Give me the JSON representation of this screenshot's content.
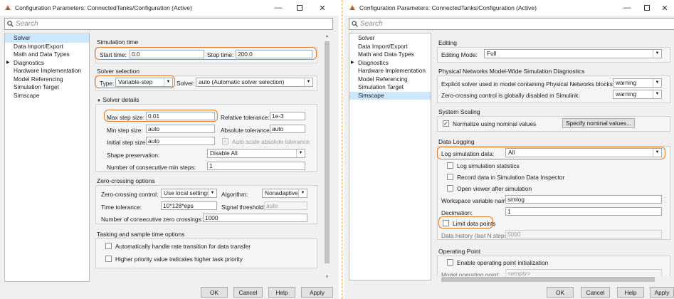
{
  "left": {
    "title": "Configuration Parameters: ConnectedTanks/Configuration (Active)",
    "search_placeholder": "Search",
    "tree": [
      "Solver",
      "Data Import/Export",
      "Math and Data Types",
      "Diagnostics",
      "Hardware Implementation",
      "Model Referencing",
      "Simulation Target",
      "Simscape"
    ],
    "sim_time": {
      "title": "Simulation time",
      "start_label": "Start time:",
      "start_value": "0.0",
      "stop_label": "Stop time:",
      "stop_value": "200.0"
    },
    "solver_selection": {
      "title": "Solver selection",
      "type_label": "Type:",
      "type_value": "Variable-step",
      "solver_label": "Solver:",
      "solver_value": "auto (Automatic solver selection)"
    },
    "solver_details": {
      "title": "Solver details",
      "max_step_label": "Max step size:",
      "max_step_value": "0.01",
      "rel_tol_label": "Relative tolerance:",
      "rel_tol_value": "1e-3",
      "min_step_label": "Min step size:",
      "min_step_value": "auto",
      "abs_tol_label": "Absolute tolerance:",
      "abs_tol_value": "auto",
      "init_step_label": "Initial step size:",
      "init_step_value": "auto",
      "auto_scale_label": "Auto scale absolute tolerance",
      "shape_label": "Shape preservation:",
      "shape_value": "Disable All",
      "consec_min_label": "Number of consecutive min steps:",
      "consec_min_value": "1"
    },
    "zero_crossing": {
      "title": "Zero-crossing options",
      "control_label": "Zero-crossing control:",
      "control_value": "Use local settings",
      "algorithm_label": "Algorithm:",
      "algorithm_value": "Nonadaptive",
      "time_tol_label": "Time tolerance:",
      "time_tol_value": "10*128*eps",
      "signal_label": "Signal threshold:",
      "signal_value": "auto",
      "consec_zc_label": "Number of consecutive zero crossings:",
      "consec_zc_value": "1000"
    },
    "tasking": {
      "title": "Tasking and sample time options",
      "opt1": "Automatically handle rate transition for data transfer",
      "opt2": "Higher priority value indicates higher task priority"
    },
    "buttons": {
      "ok": "OK",
      "cancel": "Cancel",
      "help": "Help",
      "apply": "Apply"
    }
  },
  "right": {
    "title": "Configuration Parameters: ConnectedTanks/Configuration (Active)",
    "search_placeholder": "Search",
    "tree": [
      "Solver",
      "Data Import/Export",
      "Math and Data Types",
      "Diagnostics",
      "Hardware Implementation",
      "Model Referencing",
      "Simulation Target",
      "Simscape"
    ],
    "editing": {
      "title": "Editing",
      "mode_label": "Editing Mode:",
      "mode_value": "Full"
    },
    "pn_diag": {
      "title": "Physical Networks Model-Wide Simulation Diagnostics",
      "explicit_label": "Explicit solver used in model containing Physical Networks blocks:",
      "explicit_value": "warning",
      "zc_label": "Zero-crossing control is globally disabled in Simulink:",
      "zc_value": "warning"
    },
    "scaling": {
      "title": "System Scaling",
      "normalize_label": "Normalize using nominal values",
      "specify_button": "Specify nominal values..."
    },
    "logging": {
      "title": "Data Logging",
      "log_label": "Log simulation data:",
      "log_value": "All",
      "stats_label": "Log simulation statistics",
      "record_label": "Record data in Simulation Data Inspector",
      "viewer_label": "Open viewer after simulation",
      "workspace_label": "Workspace variable name:",
      "workspace_value": "simlog",
      "decimation_label": "Decimation:",
      "decimation_value": "1",
      "limit_label": "Limit data points",
      "history_label": "Data history (last N steps):",
      "history_value": "5000"
    },
    "op_point": {
      "title": "Operating Point",
      "enable_label": "Enable operating point initialization",
      "model_op_label": "Model operating point:",
      "model_op_value": "<empty>"
    },
    "buttons": {
      "ok": "OK",
      "cancel": "Cancel",
      "help": "Help",
      "apply": "Apply"
    }
  }
}
